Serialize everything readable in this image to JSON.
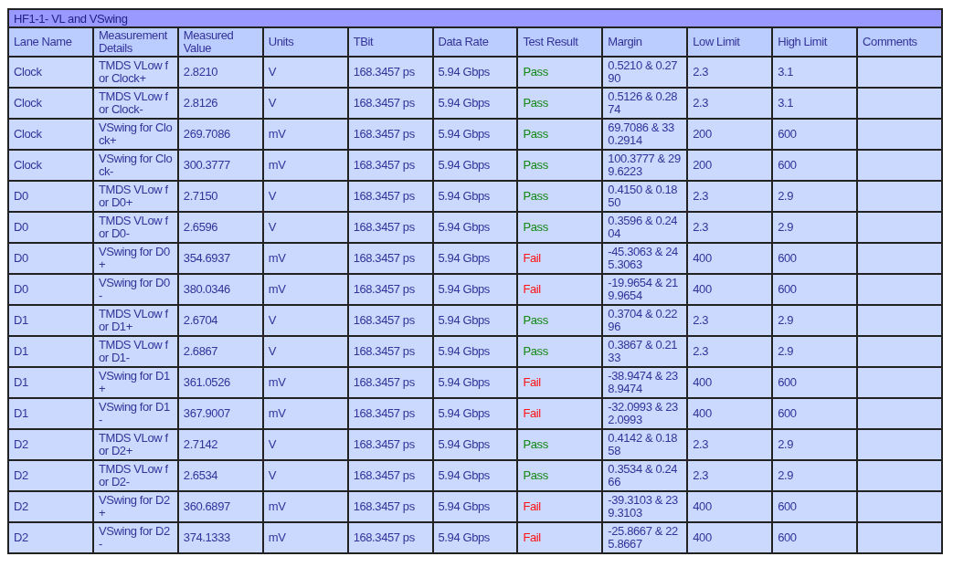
{
  "table": {
    "title": "HF1-1- VL and VSwing",
    "columns": [
      "Lane Name",
      "Measurement Details",
      "Measured Value",
      "Units",
      "TBit",
      "Data Rate",
      "Test Result",
      "Margin",
      "Low Limit",
      "High Limit",
      "Comments"
    ],
    "rows": [
      {
        "lane": "Clock",
        "details": "TMDS VLow for Clock+",
        "value": "2.8210",
        "units": "V",
        "tbit": "168.3457 ps",
        "rate": "5.94 Gbps",
        "result": "Pass",
        "passed": true,
        "margin": "0.5210 & 0.2790",
        "low": "2.3",
        "high": "3.1"
      },
      {
        "lane": "Clock",
        "details": "TMDS VLow for Clock-",
        "value": "2.8126",
        "units": "V",
        "tbit": "168.3457 ps",
        "rate": "5.94 Gbps",
        "result": "Pass",
        "passed": true,
        "margin": "0.5126 & 0.2874",
        "low": "2.3",
        "high": "3.1"
      },
      {
        "lane": "Clock",
        "details": "VSwing for Clock+",
        "value": "269.7086",
        "units": "mV",
        "tbit": "168.3457 ps",
        "rate": "5.94 Gbps",
        "result": "Pass",
        "passed": true,
        "margin": "69.7086 & 330.2914",
        "low": "200",
        "high": "600"
      },
      {
        "lane": "Clock",
        "details": "VSwing for Clock-",
        "value": "300.3777",
        "units": "mV",
        "tbit": "168.3457 ps",
        "rate": "5.94 Gbps",
        "result": "Pass",
        "passed": true,
        "margin": "100.3777 & 299.6223",
        "low": "200",
        "high": "600"
      },
      {
        "lane": "D0",
        "details": "TMDS VLow for D0+",
        "value": "2.7150",
        "units": "V",
        "tbit": "168.3457 ps",
        "rate": "5.94 Gbps",
        "result": "Pass",
        "passed": true,
        "margin": "0.4150 & 0.1850",
        "low": "2.3",
        "high": "2.9"
      },
      {
        "lane": "D0",
        "details": "TMDS VLow for D0-",
        "value": "2.6596",
        "units": "V",
        "tbit": "168.3457 ps",
        "rate": "5.94 Gbps",
        "result": "Pass",
        "passed": true,
        "margin": "0.3596 & 0.2404",
        "low": "2.3",
        "high": "2.9"
      },
      {
        "lane": "D0",
        "details": "VSwing for D0+",
        "value": "354.6937",
        "units": "mV",
        "tbit": "168.3457 ps",
        "rate": "5.94 Gbps",
        "result": "Fail",
        "passed": false,
        "margin": "-45.3063 & 245.3063",
        "low": "400",
        "high": "600"
      },
      {
        "lane": "D0",
        "details": "VSwing for D0-",
        "value": "380.0346",
        "units": "mV",
        "tbit": "168.3457 ps",
        "rate": "5.94 Gbps",
        "result": "Fail",
        "passed": false,
        "margin": "-19.9654 & 219.9654",
        "low": "400",
        "high": "600"
      },
      {
        "lane": "D1",
        "details": "TMDS VLow for D1+",
        "value": "2.6704",
        "units": "V",
        "tbit": "168.3457 ps",
        "rate": "5.94 Gbps",
        "result": "Pass",
        "passed": true,
        "margin": "0.3704 & 0.2296",
        "low": "2.3",
        "high": "2.9"
      },
      {
        "lane": "D1",
        "details": "TMDS VLow for D1-",
        "value": "2.6867",
        "units": "V",
        "tbit": "168.3457 ps",
        "rate": "5.94 Gbps",
        "result": "Pass",
        "passed": true,
        "margin": "0.3867 & 0.2133",
        "low": "2.3",
        "high": "2.9"
      },
      {
        "lane": "D1",
        "details": "VSwing for D1+",
        "value": "361.0526",
        "units": "mV",
        "tbit": "168.3457 ps",
        "rate": "5.94 Gbps",
        "result": "Fail",
        "passed": false,
        "margin": "-38.9474 & 238.9474",
        "low": "400",
        "high": "600"
      },
      {
        "lane": "D1",
        "details": "VSwing for D1-",
        "value": "367.9007",
        "units": "mV",
        "tbit": "168.3457 ps",
        "rate": "5.94 Gbps",
        "result": "Fail",
        "passed": false,
        "margin": "-32.0993 & 232.0993",
        "low": "400",
        "high": "600"
      },
      {
        "lane": "D2",
        "details": "TMDS VLow for D2+",
        "value": "2.7142",
        "units": "V",
        "tbit": "168.3457 ps",
        "rate": "5.94 Gbps",
        "result": "Pass",
        "passed": true,
        "margin": "0.4142 & 0.1858",
        "low": "2.3",
        "high": "2.9"
      },
      {
        "lane": "D2",
        "details": "TMDS VLow for D2-",
        "value": "2.6534",
        "units": "V",
        "tbit": "168.3457 ps",
        "rate": "5.94 Gbps",
        "result": "Pass",
        "passed": true,
        "margin": "0.3534 & 0.2466",
        "low": "2.3",
        "high": "2.9"
      },
      {
        "lane": "D2",
        "details": "VSwing for D2+",
        "value": "360.6897",
        "units": "mV",
        "tbit": "168.3457 ps",
        "rate": "5.94 Gbps",
        "result": "Fail",
        "passed": false,
        "margin": "-39.3103 & 239.3103",
        "low": "400",
        "high": "600"
      },
      {
        "lane": "D2",
        "details": "VSwing for D2-",
        "value": "374.1333",
        "units": "mV",
        "tbit": "168.3457 ps",
        "rate": "5.94 Gbps",
        "result": "Fail",
        "passed": false,
        "margin": "-25.8667 & 225.8667",
        "low": "400",
        "high": "600"
      }
    ]
  }
}
